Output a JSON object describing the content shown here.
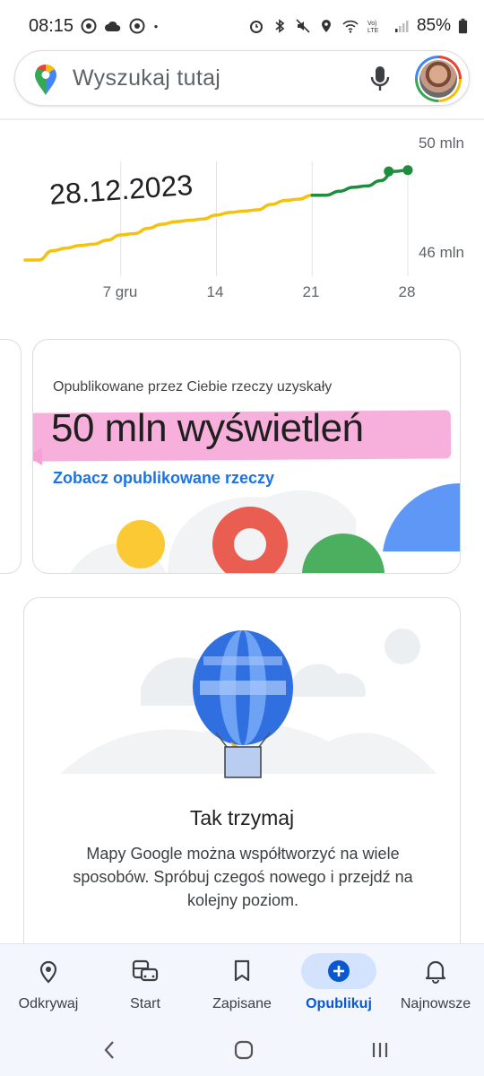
{
  "status_bar": {
    "time": "08:15",
    "battery": "85%",
    "left_icons": [
      "chrome-icon",
      "cloud-icon",
      "chrome-icon",
      "dot-icon"
    ],
    "right_icons": [
      "alarm-icon",
      "bluetooth-icon",
      "mute-icon",
      "location-icon",
      "wifi-icon",
      "volte-icon",
      "signal-icon",
      "battery-icon"
    ]
  },
  "search": {
    "placeholder": "Wyszukaj tutaj"
  },
  "chart_data": {
    "type": "line",
    "title": "28.12.2023",
    "x_tick_labels": [
      "7 gru",
      "14",
      "21",
      "28"
    ],
    "y_tick_labels": [
      "50 mln",
      "46 mln"
    ],
    "ylim": [
      46,
      50
    ],
    "grid": true,
    "series": [
      {
        "color": "#f4c20d",
        "x": [
          0,
          1,
          2,
          3,
          4,
          5,
          6,
          7,
          8,
          9,
          10,
          11,
          12,
          13,
          14,
          15,
          16,
          17,
          18,
          19,
          20,
          21
        ],
        "values": [
          46.0,
          46.0,
          46.35,
          46.45,
          46.55,
          46.6,
          46.75,
          46.95,
          47.0,
          47.2,
          47.35,
          47.45,
          47.5,
          47.55,
          47.7,
          47.8,
          47.85,
          47.9,
          48.1,
          48.25,
          48.3,
          48.45
        ]
      },
      {
        "color": "#1e8e3e",
        "x": [
          21,
          22,
          23,
          24,
          25,
          26,
          27,
          28
        ],
        "values": [
          48.45,
          48.45,
          48.6,
          48.75,
          48.8,
          49.0,
          49.35,
          49.4
        ]
      }
    ]
  },
  "stats_card": {
    "caption": "Opublikowane przez Ciebie rzeczy uzyskały",
    "value": "50 mln wyświetleń",
    "link": "Zobacz opublikowane rzeczy"
  },
  "encourage_card": {
    "title": "Tak trzymaj",
    "body": "Mapy Google można współtworzyć na wiele sposobów. Spróbuj czegoś nowego i przejdź na kolejny poziom."
  },
  "bottom_nav": {
    "items": [
      {
        "label": "Odkrywaj",
        "icon": "location-pin-icon"
      },
      {
        "label": "Start",
        "icon": "commute-icon"
      },
      {
        "label": "Zapisane",
        "icon": "bookmark-icon"
      },
      {
        "label": "Opublikuj",
        "icon": "add-circle-icon",
        "active": true
      },
      {
        "label": "Najnowsze",
        "icon": "bell-icon"
      }
    ],
    "active_color": "#0b57d0"
  }
}
